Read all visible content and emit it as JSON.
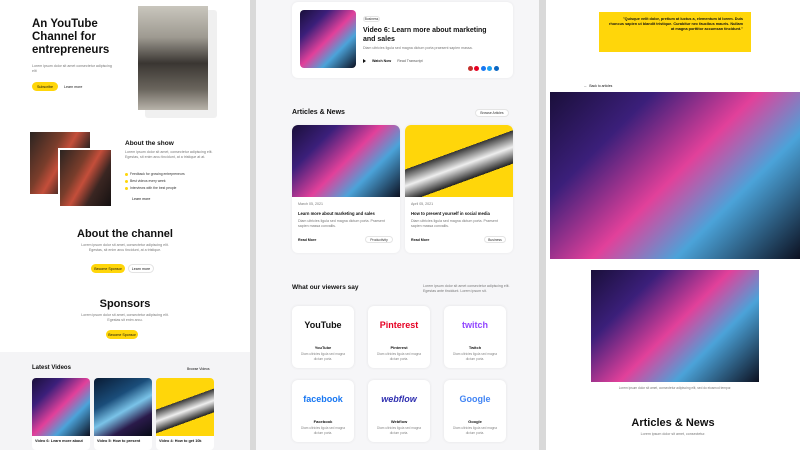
{
  "left": {
    "hero_title": "An YouTube Channel for entrepreneurs",
    "hero_sub": "Lorem ipsum dolor sit amet consectetur adipiscing elit",
    "subscribe_label": "Subscribe",
    "learn_label": "Learn more",
    "about_show_title": "About the show",
    "about_show_text": "Lorem ipsum dolor sit amet, consectetur adipiscing elit. Egestas, sit enim arcu tincidunt, at a tristique at at.",
    "bullets": [
      "Feedback for growing entrepreneurs",
      "Best videos every week",
      "Interviews with the best people"
    ],
    "about_show_link": "Learn more",
    "about_channel_title": "About the channel",
    "about_channel_text": "Lorem ipsum dolor sit amet, consectetur adipiscing elit. Egestas, sit enim arcu tincidunt, at a tristique.",
    "become_sponsor_label": "Become Sponsor",
    "learn_more2": "Learn more",
    "sponsors_title": "Sponsors",
    "sponsors_text": "Lorem ipsum dolor sit amet, consectetur adipiscing elit. Egestas sit enim arcu.",
    "sponsor_btn": "Become Sponsor",
    "latest_title": "Latest Videos",
    "browse_videos": "Browse Videos",
    "videos": [
      "Video 6: Learn more about",
      "Video 5: How to present",
      "Video 4: How to get 10k"
    ]
  },
  "middle": {
    "featured_tag": "Business",
    "featured_title": "Video 6: Learn more about marketing and sales",
    "featured_desc": "Diam ultricies ligula sed magna dictum porta praesent sapien massa.",
    "watch_label": "Watch Now",
    "watch_sub": "Read Transcript",
    "articles_title": "Articles & News",
    "browse_articles": "Browse Articles",
    "articles": [
      {
        "date": "March 05, 2021",
        "title": "Learn more about marketing and sales",
        "desc": "Diam ultricies ligula sed magna dictum porta. Praesent sapien massa convallis.",
        "read": "Read More",
        "tag": "Productivity"
      },
      {
        "date": "April 05, 2021",
        "title": "How to present yourself in social media",
        "desc": "Diam ultricies ligula sed magna dictum porta. Praesent sapien massa convallis.",
        "read": "Read More",
        "tag": "Business"
      }
    ],
    "viewers_title": "What our viewers say",
    "viewers_text": "Lorem ipsum dolor sit amet consectetur adipiscing elit. Egestas ante tincidunt. Lorem ipsum sit.",
    "brands": [
      {
        "logo": "YouTube",
        "name": "YouTube",
        "desc": "Diam ultricies ligula sed magna dictum porta.",
        "color": "#111111"
      },
      {
        "logo": "Pinterest",
        "name": "Pinterest",
        "desc": "Diam ultricies ligula sed magna dictum porta.",
        "color": "#e60023"
      },
      {
        "logo": "twitch",
        "name": "Twitch",
        "desc": "Diam ultricies ligula sed magna dictum porta.",
        "color": "#9146ff"
      },
      {
        "logo": "facebook",
        "name": "Facebook",
        "desc": "Diam ultricies ligula sed magna dictum porta.",
        "color": "#1877f2"
      },
      {
        "logo": "webflow",
        "name": "Webflow",
        "desc": "Diam ultricies ligula sed magna dictum porta.",
        "color": "#2f2fb0"
      },
      {
        "logo": "Google",
        "name": "Google",
        "desc": "Diam ultricies ligula sed magna dictum porta.",
        "color": "#4285f4"
      }
    ]
  },
  "right": {
    "quote": "\"Quisque velit dolor, pretium at luctus a, elementum id lorem. Duis rhoncus sapien ut blandit tristique. Curabitur nec faucibus mauris. Nullam at magna porttitor accumsan tincidunt.\"",
    "back_link": "Back to articles",
    "caption": "Lorem ipsum dolor sit amet, consectetur adipiscing elit, sed do eiusmod tempor.",
    "articles_title": "Articles & News",
    "articles_text": "Lorem ipsum dolor sit amet, consectetur."
  },
  "colors": {
    "accent": "#ffd60a",
    "text": "#111111"
  }
}
